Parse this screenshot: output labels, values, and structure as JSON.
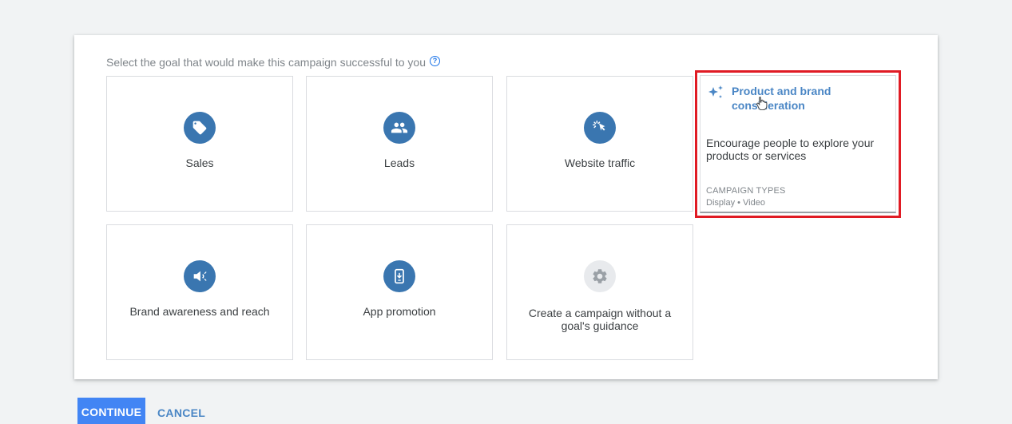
{
  "prompt": "Select the goal that would make this campaign successful to you",
  "goals": [
    {
      "label": "Sales",
      "icon": "tag-icon"
    },
    {
      "label": "Leads",
      "icon": "people-icon"
    },
    {
      "label": "Website traffic",
      "icon": "cursor-click-icon"
    },
    {
      "label": "Brand awareness and reach",
      "icon": "megaphone-icon"
    },
    {
      "label": "App promotion",
      "icon": "mobile-download-icon"
    },
    {
      "label": "Create a campaign without a goal's guidance",
      "icon": "gear-icon"
    }
  ],
  "selected_goal": {
    "title": "Product and brand consideration",
    "description": "Encourage people to explore your products or services",
    "campaign_types_label": "CAMPAIGN TYPES",
    "campaign_types": "Display • Video",
    "icon": "sparkle-icon"
  },
  "actions": {
    "continue": "CONTINUE",
    "cancel": "CANCEL"
  },
  "colors": {
    "accent": "#3a76b0",
    "highlight_border": "#e01b24",
    "primary_button": "#4285f4"
  }
}
